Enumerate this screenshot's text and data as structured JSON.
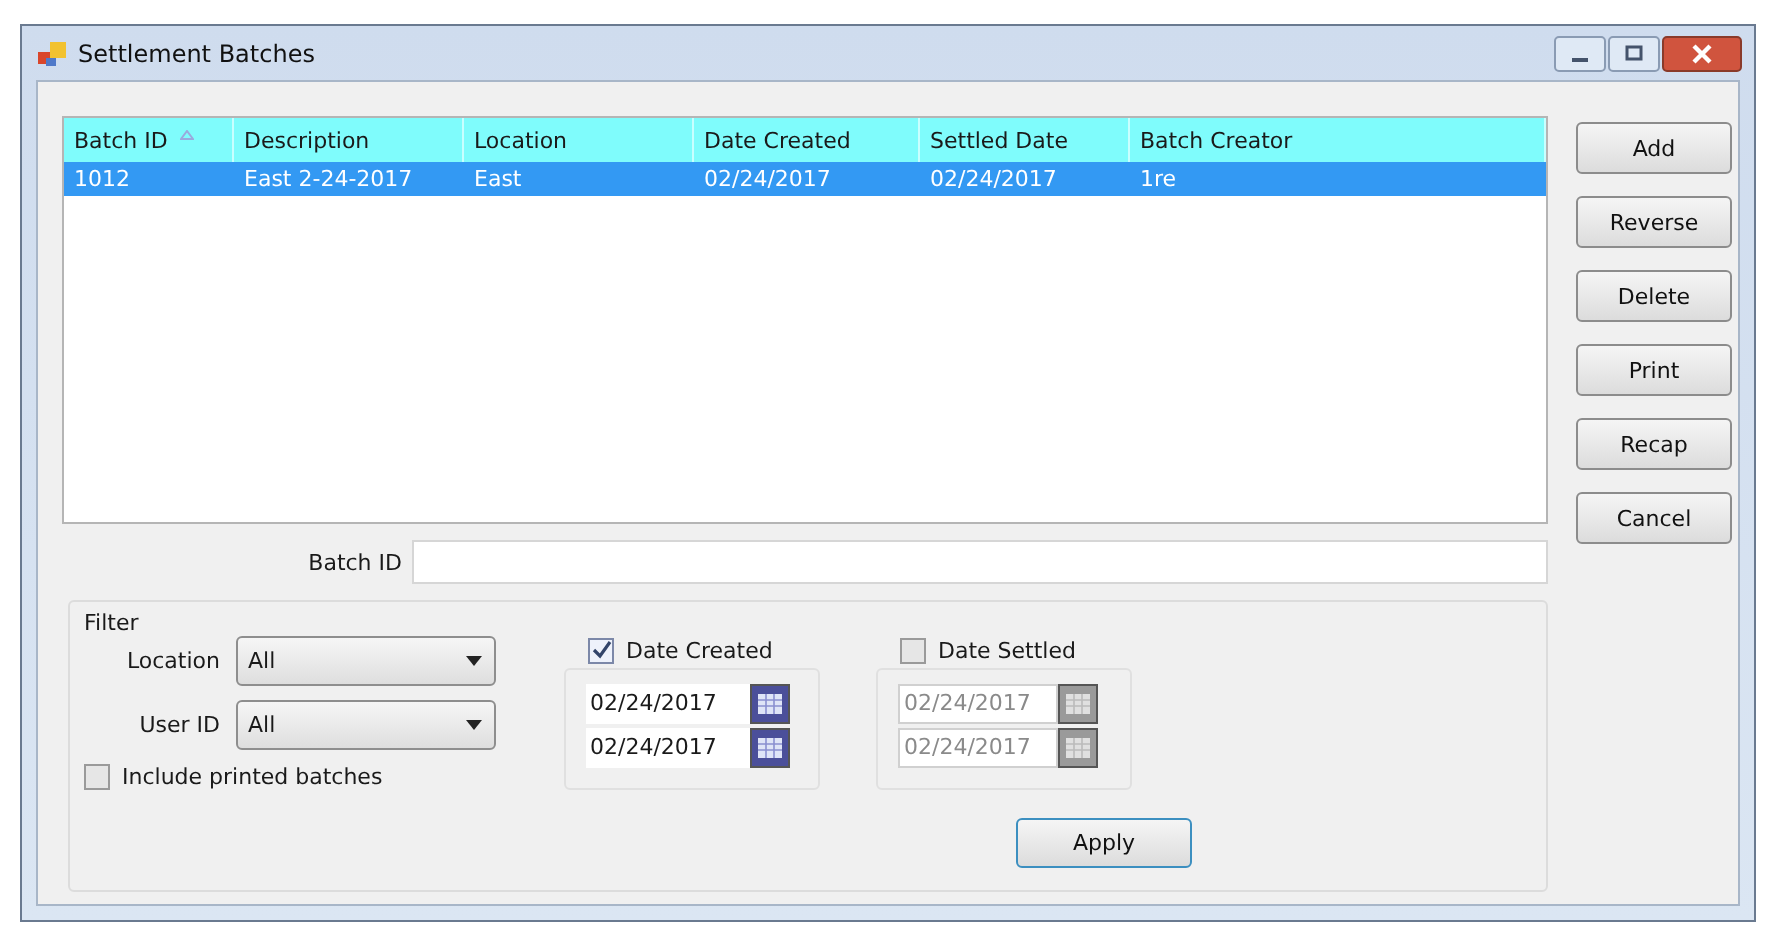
{
  "window": {
    "title": "Settlement Batches"
  },
  "table": {
    "columns": [
      {
        "label": "Batch ID",
        "sorted": true
      },
      {
        "label": "Description",
        "sorted": false
      },
      {
        "label": "Location",
        "sorted": false
      },
      {
        "label": "Date Created",
        "sorted": false
      },
      {
        "label": "Settled Date",
        "sorted": false
      },
      {
        "label": "Batch Creator",
        "sorted": false
      }
    ],
    "rows": [
      {
        "cells": [
          "1012",
          "East 2-24-2017",
          "East",
          "02/24/2017",
          "02/24/2017",
          "1re"
        ],
        "selected": true
      }
    ]
  },
  "buttons": [
    "Add",
    "Reverse",
    "Delete",
    "Print",
    "Recap",
    "Cancel"
  ],
  "batch_id": {
    "label": "Batch ID"
  },
  "filter": {
    "title": "Filter",
    "dropdowns": [
      {
        "label": "Location",
        "value": "All"
      },
      {
        "label": "User ID",
        "value": "All"
      }
    ],
    "include_printed": {
      "label": "Include printed batches",
      "checked": false
    },
    "date_groups": [
      {
        "label": "Date Created",
        "checked": true,
        "dates": [
          "02/24/2017",
          "02/24/2017"
        ]
      },
      {
        "label": "Date Settled",
        "checked": false,
        "dates": [
          "02/24/2017",
          "02/24/2017"
        ]
      }
    ],
    "apply": "Apply"
  }
}
